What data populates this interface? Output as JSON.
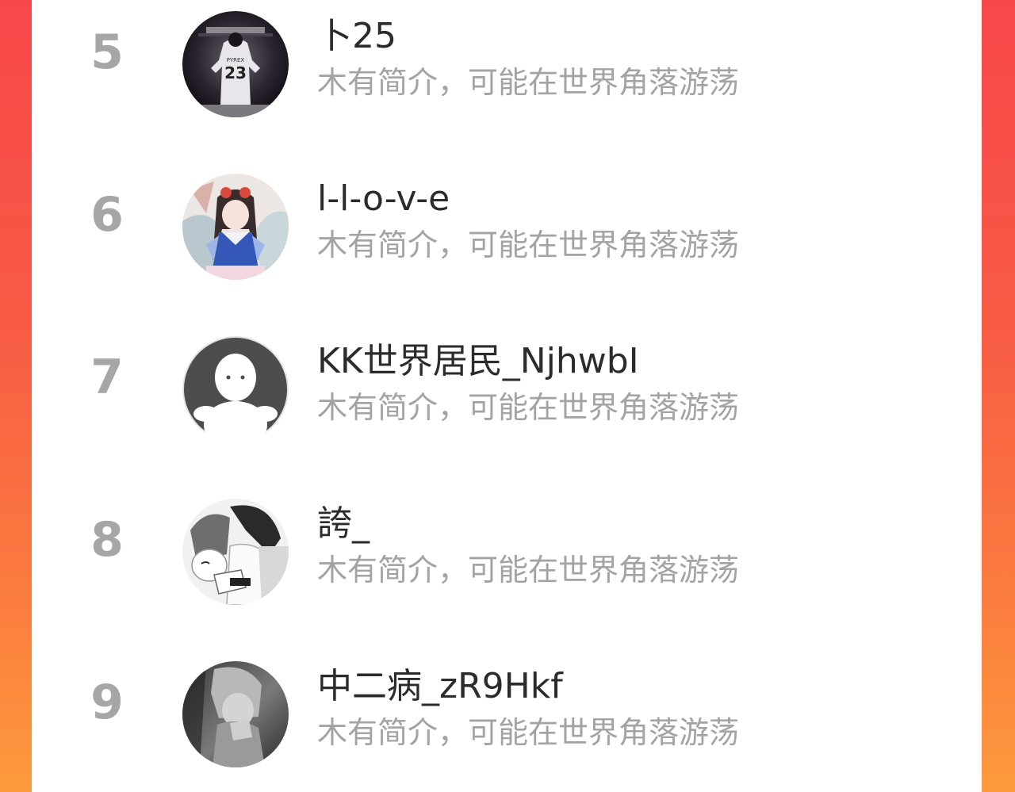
{
  "ranking": {
    "bio_placeholder": "木有简介，可能在世界角落游荡",
    "rows": [
      {
        "rank": "5",
        "name": "卜25",
        "bio": "木有简介，可能在世界角落游荡",
        "jersey": "23",
        "jersey_name": "PYREX"
      },
      {
        "rank": "6",
        "name": "l-l-o-v-e",
        "bio": "木有简介，可能在世界角落游荡"
      },
      {
        "rank": "7",
        "name": "KK世界居民_NjhwbI",
        "bio": "木有简介，可能在世界角落游荡"
      },
      {
        "rank": "8",
        "name": "誇_",
        "bio": "木有简介，可能在世界角落游荡"
      },
      {
        "rank": "9",
        "name": "中二病_zR9Hkf",
        "bio": "木有简介，可能在世界角落游荡"
      }
    ]
  },
  "colors": {
    "background_top": "#f7474a",
    "background_bottom": "#fd9a3d",
    "rank_text": "#a6a6a6",
    "name_text": "#2b2b2b",
    "bio_text": "#a3a3a3"
  }
}
